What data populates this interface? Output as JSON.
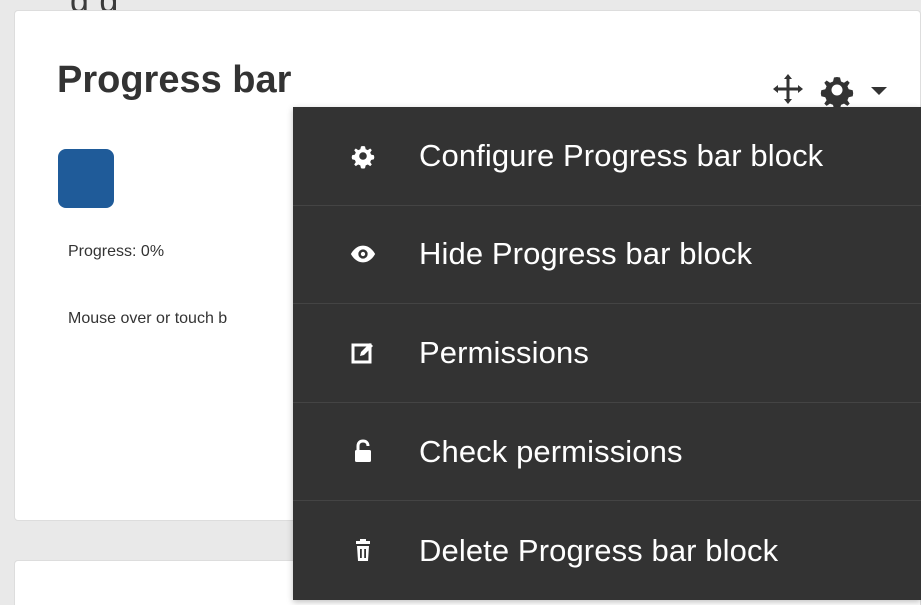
{
  "top_partial_text": "g          g",
  "block": {
    "title": "Progress bar",
    "progress_text": "Progress: 0%",
    "help_text": "Mouse over or touch b"
  },
  "controls": {
    "move_icon": "move-icon",
    "settings_icon": "gear-icon",
    "dropdown_icon": "chevron-down-icon"
  },
  "menu": {
    "items": [
      {
        "label": "Configure Progress bar block",
        "icon": "gear-icon"
      },
      {
        "label": "Hide Progress bar block",
        "icon": "eye-icon"
      },
      {
        "label": "Permissions",
        "icon": "edit-icon"
      },
      {
        "label": "Check permissions",
        "icon": "unlock-icon"
      },
      {
        "label": "Delete Progress bar block",
        "icon": "trash-icon"
      }
    ]
  },
  "colors": {
    "menu_background": "#333333",
    "progress_square": "#1f5b99",
    "text_primary": "#333333"
  }
}
